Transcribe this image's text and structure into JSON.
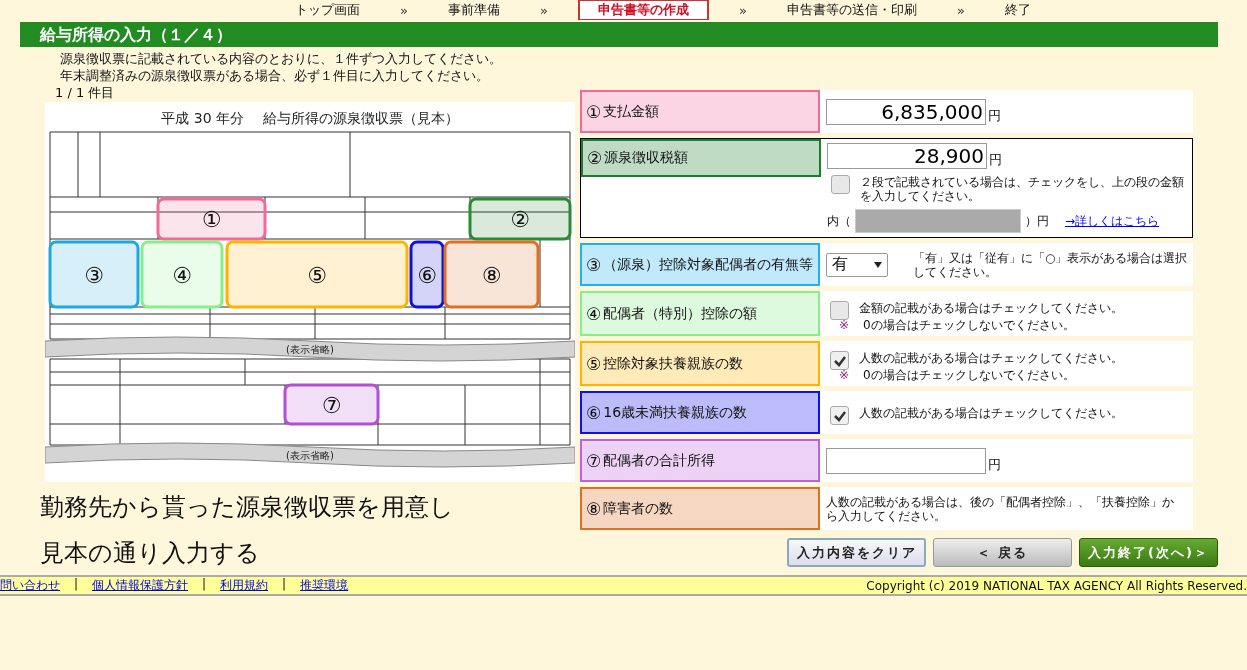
{
  "nav": [
    {
      "kind": "step",
      "label": "トップ画面",
      "selected": false
    },
    {
      "kind": "sep",
      "label": "»"
    },
    {
      "kind": "step",
      "label": "事前準備",
      "selected": false
    },
    {
      "kind": "sep",
      "label": "»"
    },
    {
      "kind": "step",
      "label": "申告書等の作成",
      "selected": true
    },
    {
      "kind": "sep",
      "label": "»"
    },
    {
      "kind": "step",
      "label": "申告書等の送信・印刷",
      "selected": false
    },
    {
      "kind": "sep",
      "label": "»"
    },
    {
      "kind": "step",
      "label": "終了",
      "selected": false
    }
  ],
  "page_title": "給与所得の入力（１／４）",
  "intro": [
    "源泉徴収票に記載されている内容のとおりに、１件ずつ入力してください。",
    "年末調整済みの源泉徴収票がある場合、必ず１件目に入力してください。"
  ],
  "counter": "1 / 1 件目",
  "sample": {
    "title": "平成 30 年分　 給与所得の源泉徴収票（見本）",
    "boxes": [
      {
        "number": "①",
        "color": "#f06a9a"
      },
      {
        "number": "②",
        "color": "#2a8a36"
      },
      {
        "number": "③",
        "color": "#1fa7e0"
      },
      {
        "number": "④",
        "color": "#88ee88"
      },
      {
        "number": "⑤",
        "color": "#ffb300"
      },
      {
        "number": "⑥",
        "color": "#1010dd"
      },
      {
        "number": "⑦",
        "color": "#b44ed6"
      },
      {
        "number": "⑧",
        "color": "#e07020"
      }
    ],
    "omitted": [
      "(表示省略)",
      "(表示省略)"
    ]
  },
  "caption": [
    "勤務先から貰った源泉徴収票を用意し",
    "見本の通り入力する"
  ],
  "rows": [
    {
      "kind": "amount",
      "number": "①",
      "label": "支払金額",
      "color": "#f06a9a",
      "value": "6,835,000",
      "unit": "円"
    },
    {
      "kind": "split",
      "number": "②",
      "label": "源泉徴収税額",
      "color": "#1a7f2a",
      "value": "28,900",
      "unit": "円",
      "check": {
        "checked": false,
        "text": "２段で記載されている場合は、チェックをし、上の段の金額を入力してください。"
      },
      "inner": {
        "prefix": "内（",
        "suffix": "）円",
        "disabled": true,
        "link": "→詳しくはこちら"
      }
    },
    {
      "kind": "select",
      "number": "③",
      "label": "（源泉）控除対象配偶者の有無等",
      "color": "#1fb0f0",
      "value": "有",
      "note": "「有」又は「従有」に「○」表示がある場合は選択してください。"
    },
    {
      "kind": "check",
      "number": "④",
      "label": "配偶者（特別）控除の額",
      "color": "#88ee88",
      "checked": false,
      "text": "金額の記載がある場合はチェックしてください。",
      "note_mark": "※",
      "note": "0の場合はチェックしないでください。"
    },
    {
      "kind": "check",
      "number": "⑤",
      "label": "控除対象扶養親族の数",
      "color": "#ffb300",
      "checked": true,
      "text": "人数の記載がある場合はチェックしてください。",
      "note_mark": "※",
      "note": "0の場合はチェックしないでください。"
    },
    {
      "kind": "check",
      "number": "⑥",
      "label": "16歳未満扶養親族の数",
      "color": "#1010ee",
      "checked": true,
      "text": "人数の記載がある場合はチェックしてください。"
    },
    {
      "kind": "amount",
      "number": "⑦",
      "label": "配偶者の合計所得",
      "color": "#c060e0",
      "value": "",
      "unit": "円"
    },
    {
      "kind": "note",
      "number": "⑧",
      "label": "障害者の数",
      "color": "#e07020",
      "note": "人数の記載がある場合は、後の「配偶者控除」、「扶養控除」から入力してください。"
    }
  ],
  "buttons": [
    {
      "kind": "clear",
      "label": "入力内容をクリア"
    },
    {
      "kind": "back",
      "label": "＜ 戻る"
    },
    {
      "kind": "next",
      "label": "入力終了(次へ)＞"
    }
  ],
  "footer": {
    "links": [
      {
        "kind": "link",
        "label": "問い合わせ"
      },
      {
        "kind": "sep",
        "label": "|"
      },
      {
        "kind": "link",
        "label": "個人情報保護方針"
      },
      {
        "kind": "sep",
        "label": "|"
      },
      {
        "kind": "link",
        "label": "利用規約"
      },
      {
        "kind": "sep",
        "label": "|"
      },
      {
        "kind": "link",
        "label": "推奨環境"
      }
    ],
    "copyright": "Copyright (c) 2019 NATIONAL TAX AGENCY All Rights Reserved."
  }
}
